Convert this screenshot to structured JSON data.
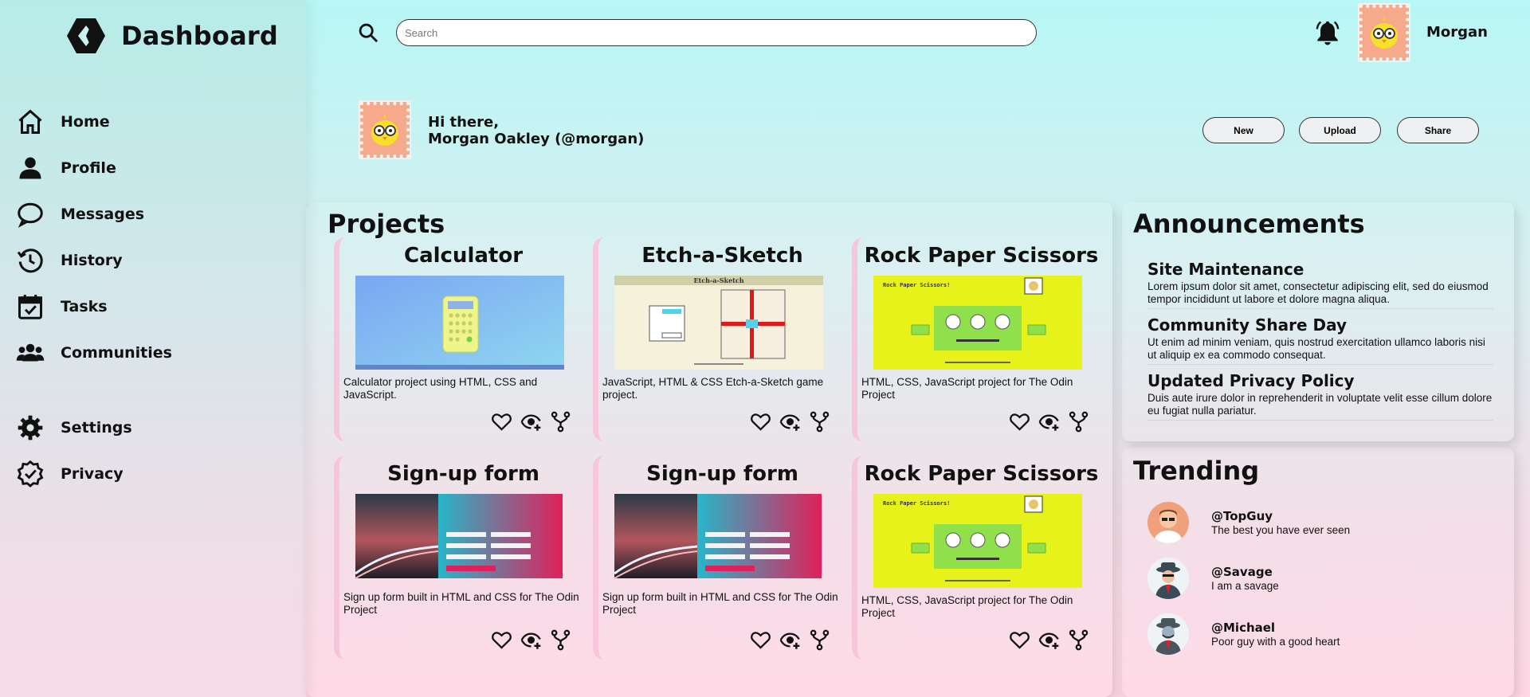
{
  "brand": {
    "title": "Dashboard",
    "logo_icon": "hexagon-logo-icon"
  },
  "sidebar": {
    "items": [
      {
        "label": "Home",
        "icon": "home-icon"
      },
      {
        "label": "Profile",
        "icon": "person-icon"
      },
      {
        "label": "Messages",
        "icon": "chat-bubble-icon"
      },
      {
        "label": "History",
        "icon": "history-icon"
      },
      {
        "label": "Tasks",
        "icon": "calendar-check-icon"
      },
      {
        "label": "Communities",
        "icon": "group-icon"
      },
      {
        "label": "Settings",
        "icon": "gear-icon"
      },
      {
        "label": "Privacy",
        "icon": "verified-badge-icon"
      }
    ]
  },
  "header": {
    "search_placeholder": "Search",
    "user_name": "Morgan"
  },
  "greeting": {
    "line1": "Hi there,",
    "line2": "Morgan Oakley (@morgan)"
  },
  "actions": {
    "new": "New",
    "upload": "Upload",
    "share": "Share"
  },
  "projects": {
    "title": "Projects",
    "cards": [
      {
        "title": "Calculator",
        "desc": "Calculator project using HTML, CSS and JavaScript."
      },
      {
        "title": "Etch-a-Sketch",
        "desc": "JavaScript, HTML & CSS Etch-a-Sketch game project."
      },
      {
        "title": "Rock Paper Scissors",
        "desc": "HTML, CSS, JavaScript project for The Odin Project"
      },
      {
        "title": "Sign-up form",
        "desc": "Sign up form built in HTML and CSS for The Odin Project"
      },
      {
        "title": "Sign-up form",
        "desc": "Sign up form built in HTML and CSS for The Odin Project"
      },
      {
        "title": "Rock Paper Scissors",
        "desc": "HTML, CSS, JavaScript project for The Odin Project"
      }
    ],
    "thumb_text": {
      "etch": "Etch-a-Sketch",
      "rps": "Rock Paper Scissors!"
    }
  },
  "announcements": {
    "title": "Announcements",
    "items": [
      {
        "title": "Site Maintenance",
        "text": "Lorem ipsum dolor sit amet, consectetur adipiscing elit, sed do eiusmod tempor incididunt ut labore et dolore magna aliqua."
      },
      {
        "title": "Community Share Day",
        "text": "Ut enim ad minim veniam, quis nostrud exercitation ullamco laboris nisi ut aliquip ex ea commodo consequat."
      },
      {
        "title": "Updated Privacy Policy",
        "text": "Duis aute irure dolor in reprehenderit in voluptate velit esse cillum dolore eu fugiat nulla pariatur."
      }
    ]
  },
  "trending": {
    "title": "Trending",
    "items": [
      {
        "handle": "@TopGuy",
        "text": "The best you have ever seen"
      },
      {
        "handle": "@Savage",
        "text": "I am a savage"
      },
      {
        "handle": "@Michael",
        "text": "Poor guy with a good heart"
      }
    ]
  },
  "colors": {
    "accent_pink": "#f7c6dc",
    "avatar_bg": "#f6a98b",
    "rps_bg": "#e6f21a"
  }
}
